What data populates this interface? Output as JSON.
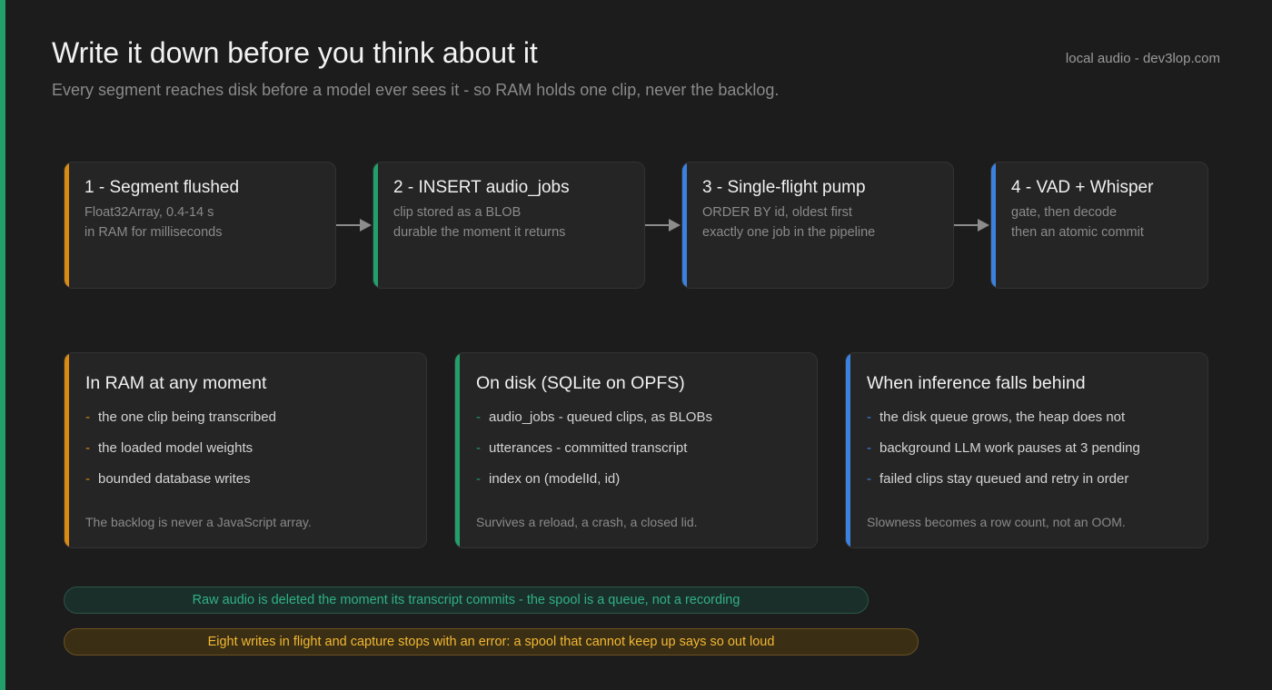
{
  "header": {
    "title": "Write it down before you think about it",
    "subtitle": "Every segment reaches disk before a model ever sees it - so RAM holds one clip, never the backlog.",
    "site": "local audio - dev3lop.com"
  },
  "colors": {
    "accent_green": "#22a06b",
    "orange": "#d98a12",
    "green": "#22a06b",
    "blue": "#3b82e0",
    "arrow": "#8c8c8c"
  },
  "steps": [
    {
      "title": "1 - Segment flushed",
      "line1": "Float32Array, 0.4-14 s",
      "line2": "in RAM for milliseconds"
    },
    {
      "title": "2 - INSERT audio_jobs",
      "line1": "clip stored as a BLOB",
      "line2": "durable the moment it returns"
    },
    {
      "title": "3 - Single-flight pump",
      "line1": "ORDER BY id, oldest first",
      "line2": "exactly one job in the pipeline"
    },
    {
      "title": "4 - VAD + Whisper",
      "line1": "gate, then decode",
      "line2": "then an atomic commit"
    }
  ],
  "panels": [
    {
      "title": "In RAM at any moment",
      "dash": "-",
      "items": [
        "the one clip being transcribed",
        "the loaded model weights",
        "bounded database writes"
      ],
      "footer": "The backlog is never a JavaScript array."
    },
    {
      "title": "On disk (SQLite on OPFS)",
      "dash": "-",
      "items": [
        "audio_jobs - queued clips, as BLOBs",
        "utterances - committed transcript",
        "index on (modelId, id)"
      ],
      "footer": "Survives a reload, a crash, a closed lid."
    },
    {
      "title": "When inference falls behind",
      "dash": "-",
      "items": [
        "the disk queue grows, the heap does not",
        "background LLM work pauses at 3 pending",
        "failed clips stay queued and retry in order"
      ],
      "footer": "Slowness becomes a row count, not an OOM."
    }
  ],
  "callouts": {
    "green": "Raw audio is deleted the moment its transcript commits - the spool is a queue, not a recording",
    "amber": "Eight writes in flight and capture stops with an error: a spool that cannot keep up says so out loud"
  }
}
